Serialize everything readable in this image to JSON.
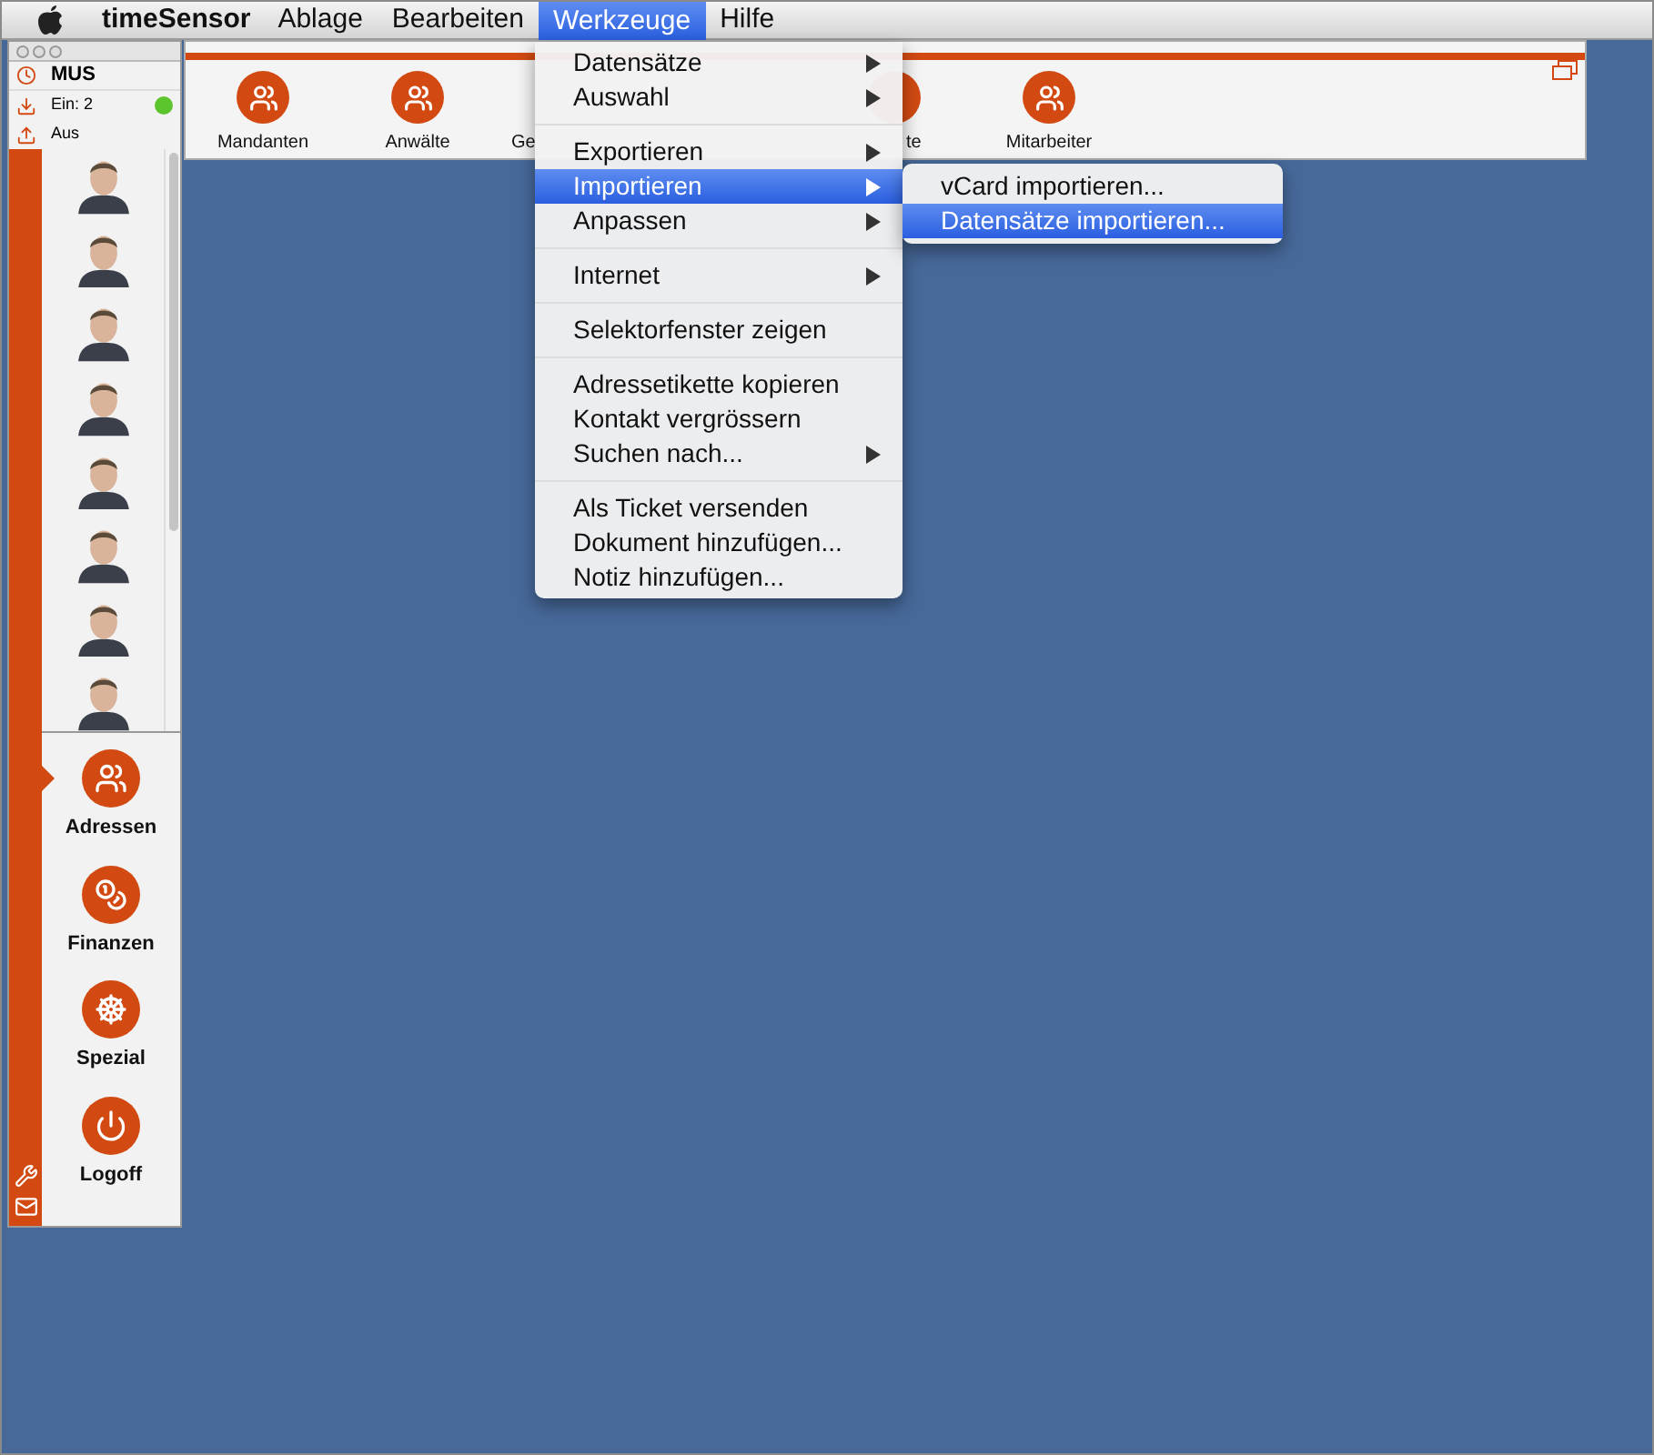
{
  "menubar": {
    "app": "timeSensor",
    "items": [
      {
        "label": "Ablage",
        "selected": false
      },
      {
        "label": "Bearbeiten",
        "selected": false
      },
      {
        "label": "Werkzeuge",
        "selected": true
      },
      {
        "label": "Hilfe",
        "selected": false
      }
    ]
  },
  "side_window": {
    "user": "MUS",
    "incoming": "Ein: 2",
    "online": true,
    "outgoing": "Aus",
    "nav": [
      {
        "label": "Adressen",
        "kind": "people",
        "selected": true
      },
      {
        "label": "Finanzen",
        "kind": "coins",
        "selected": false
      },
      {
        "label": "Spezial",
        "kind": "wheel",
        "selected": false
      },
      {
        "label": "Logoff",
        "kind": "power",
        "selected": false
      }
    ]
  },
  "toolbar": [
    {
      "label": "Mandanten",
      "kind": "full"
    },
    {
      "label": "Anwälte",
      "kind": "full"
    },
    {
      "label": "Ge",
      "kind": "cut_left"
    },
    {
      "label": "te",
      "kind": "cut_right"
    },
    {
      "label": "Mitarbeiter",
      "kind": "full"
    }
  ],
  "menu": [
    [
      {
        "label": "Datensätze",
        "submenu": true,
        "selected": false
      },
      {
        "label": "Auswahl",
        "submenu": true,
        "selected": false
      }
    ],
    [
      {
        "label": "Exportieren",
        "submenu": true,
        "selected": false
      },
      {
        "label": "Importieren",
        "submenu": true,
        "selected": true
      },
      {
        "label": "Anpassen",
        "submenu": true,
        "selected": false
      }
    ],
    [
      {
        "label": "Internet",
        "submenu": true,
        "selected": false
      }
    ],
    [
      {
        "label": "Selektorfenster zeigen",
        "submenu": false,
        "selected": false
      }
    ],
    [
      {
        "label": "Adressetikette kopieren",
        "submenu": false,
        "selected": false
      },
      {
        "label": "Kontakt vergrössern",
        "submenu": false,
        "selected": false
      },
      {
        "label": "Suchen nach...",
        "submenu": true,
        "selected": false
      }
    ],
    [
      {
        "label": "Als Ticket versenden",
        "submenu": false,
        "selected": false
      },
      {
        "label": "Dokument hinzufügen...",
        "submenu": false,
        "selected": false
      },
      {
        "label": "Notiz hinzufügen...",
        "submenu": false,
        "selected": false
      }
    ]
  ],
  "submenu": [
    {
      "label": "vCard importieren...",
      "selected": false
    },
    {
      "label": "Datensätze importieren...",
      "selected": true
    }
  ]
}
